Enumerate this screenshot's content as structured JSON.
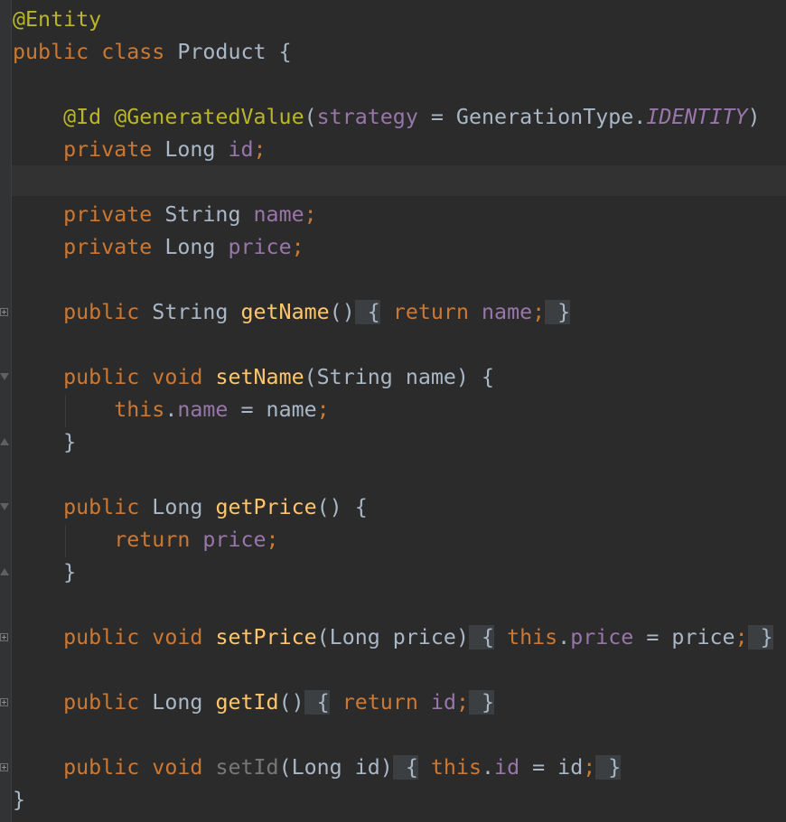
{
  "editor": {
    "colors": {
      "background": "#2b2b2b",
      "text": "#a9b7c6",
      "keyword": "#cc7832",
      "annotation": "#bbb529",
      "field": "#9876aa",
      "method": "#ffc66d",
      "folded_region": "#3c3f41"
    },
    "code": {
      "l1": {
        "annotation": "@Entity"
      },
      "l2": {
        "kw_public": "public",
        "kw_class": "class",
        "class_name": "Product",
        "brace": "{"
      },
      "l4": {
        "ann_id": "@Id",
        "ann_generated": "@GeneratedValue",
        "p1": "(",
        "param_strategy": "strategy",
        "p2": " = GenerationType.",
        "constant": "IDENTITY",
        "p3": ")"
      },
      "l5": {
        "kw": "private",
        "type": "Long",
        "field": "id",
        "semi": ";"
      },
      "l7": {
        "kw": "private",
        "type": "String",
        "field": "name",
        "semi": ";"
      },
      "l8": {
        "kw": "private",
        "type": "Long",
        "field": "price",
        "semi": ";"
      },
      "l10": {
        "kw": "public",
        "type": "String",
        "method": "getName",
        "parens": "()",
        "fold_open": " {",
        "ret_kw": "return",
        "field": "name",
        "semi": ";",
        "fold_close": " }"
      },
      "l12": {
        "kw_public": "public",
        "kw_void": "void",
        "method": "setName",
        "sig": "(String name) {"
      },
      "l13": {
        "kw_this": "this",
        "dot": ".",
        "field": "name",
        "rest": " = name",
        "semi": ";"
      },
      "l14": {
        "brace": "}"
      },
      "l16": {
        "kw": "public",
        "type": "Long",
        "method": "getPrice",
        "sig": "() {"
      },
      "l17": {
        "ret_kw": "return",
        "field": "price",
        "semi": ";"
      },
      "l18": {
        "brace": "}"
      },
      "l20": {
        "kw_public": "public",
        "kw_void": "void",
        "method": "setPrice",
        "sig": "(Long price)",
        "fold_open": " {",
        "kw_this": "this",
        "dot": ".",
        "field": "price",
        "rest": " = price",
        "semi": ";",
        "fold_close": " }"
      },
      "l22": {
        "kw": "public",
        "type": "Long",
        "method": "getId",
        "parens": "()",
        "fold_open": " {",
        "ret_kw": "return",
        "field": "id",
        "semi": ";",
        "fold_close": " }"
      },
      "l24": {
        "kw_public": "public",
        "kw_void": "void",
        "method": "setId",
        "sig": "(Long id)",
        "fold_open": " {",
        "kw_this": "this",
        "dot": ".",
        "field": "id",
        "rest": " = id",
        "semi": ";",
        "fold_close": " }"
      },
      "l25": {
        "brace": "}"
      }
    }
  }
}
